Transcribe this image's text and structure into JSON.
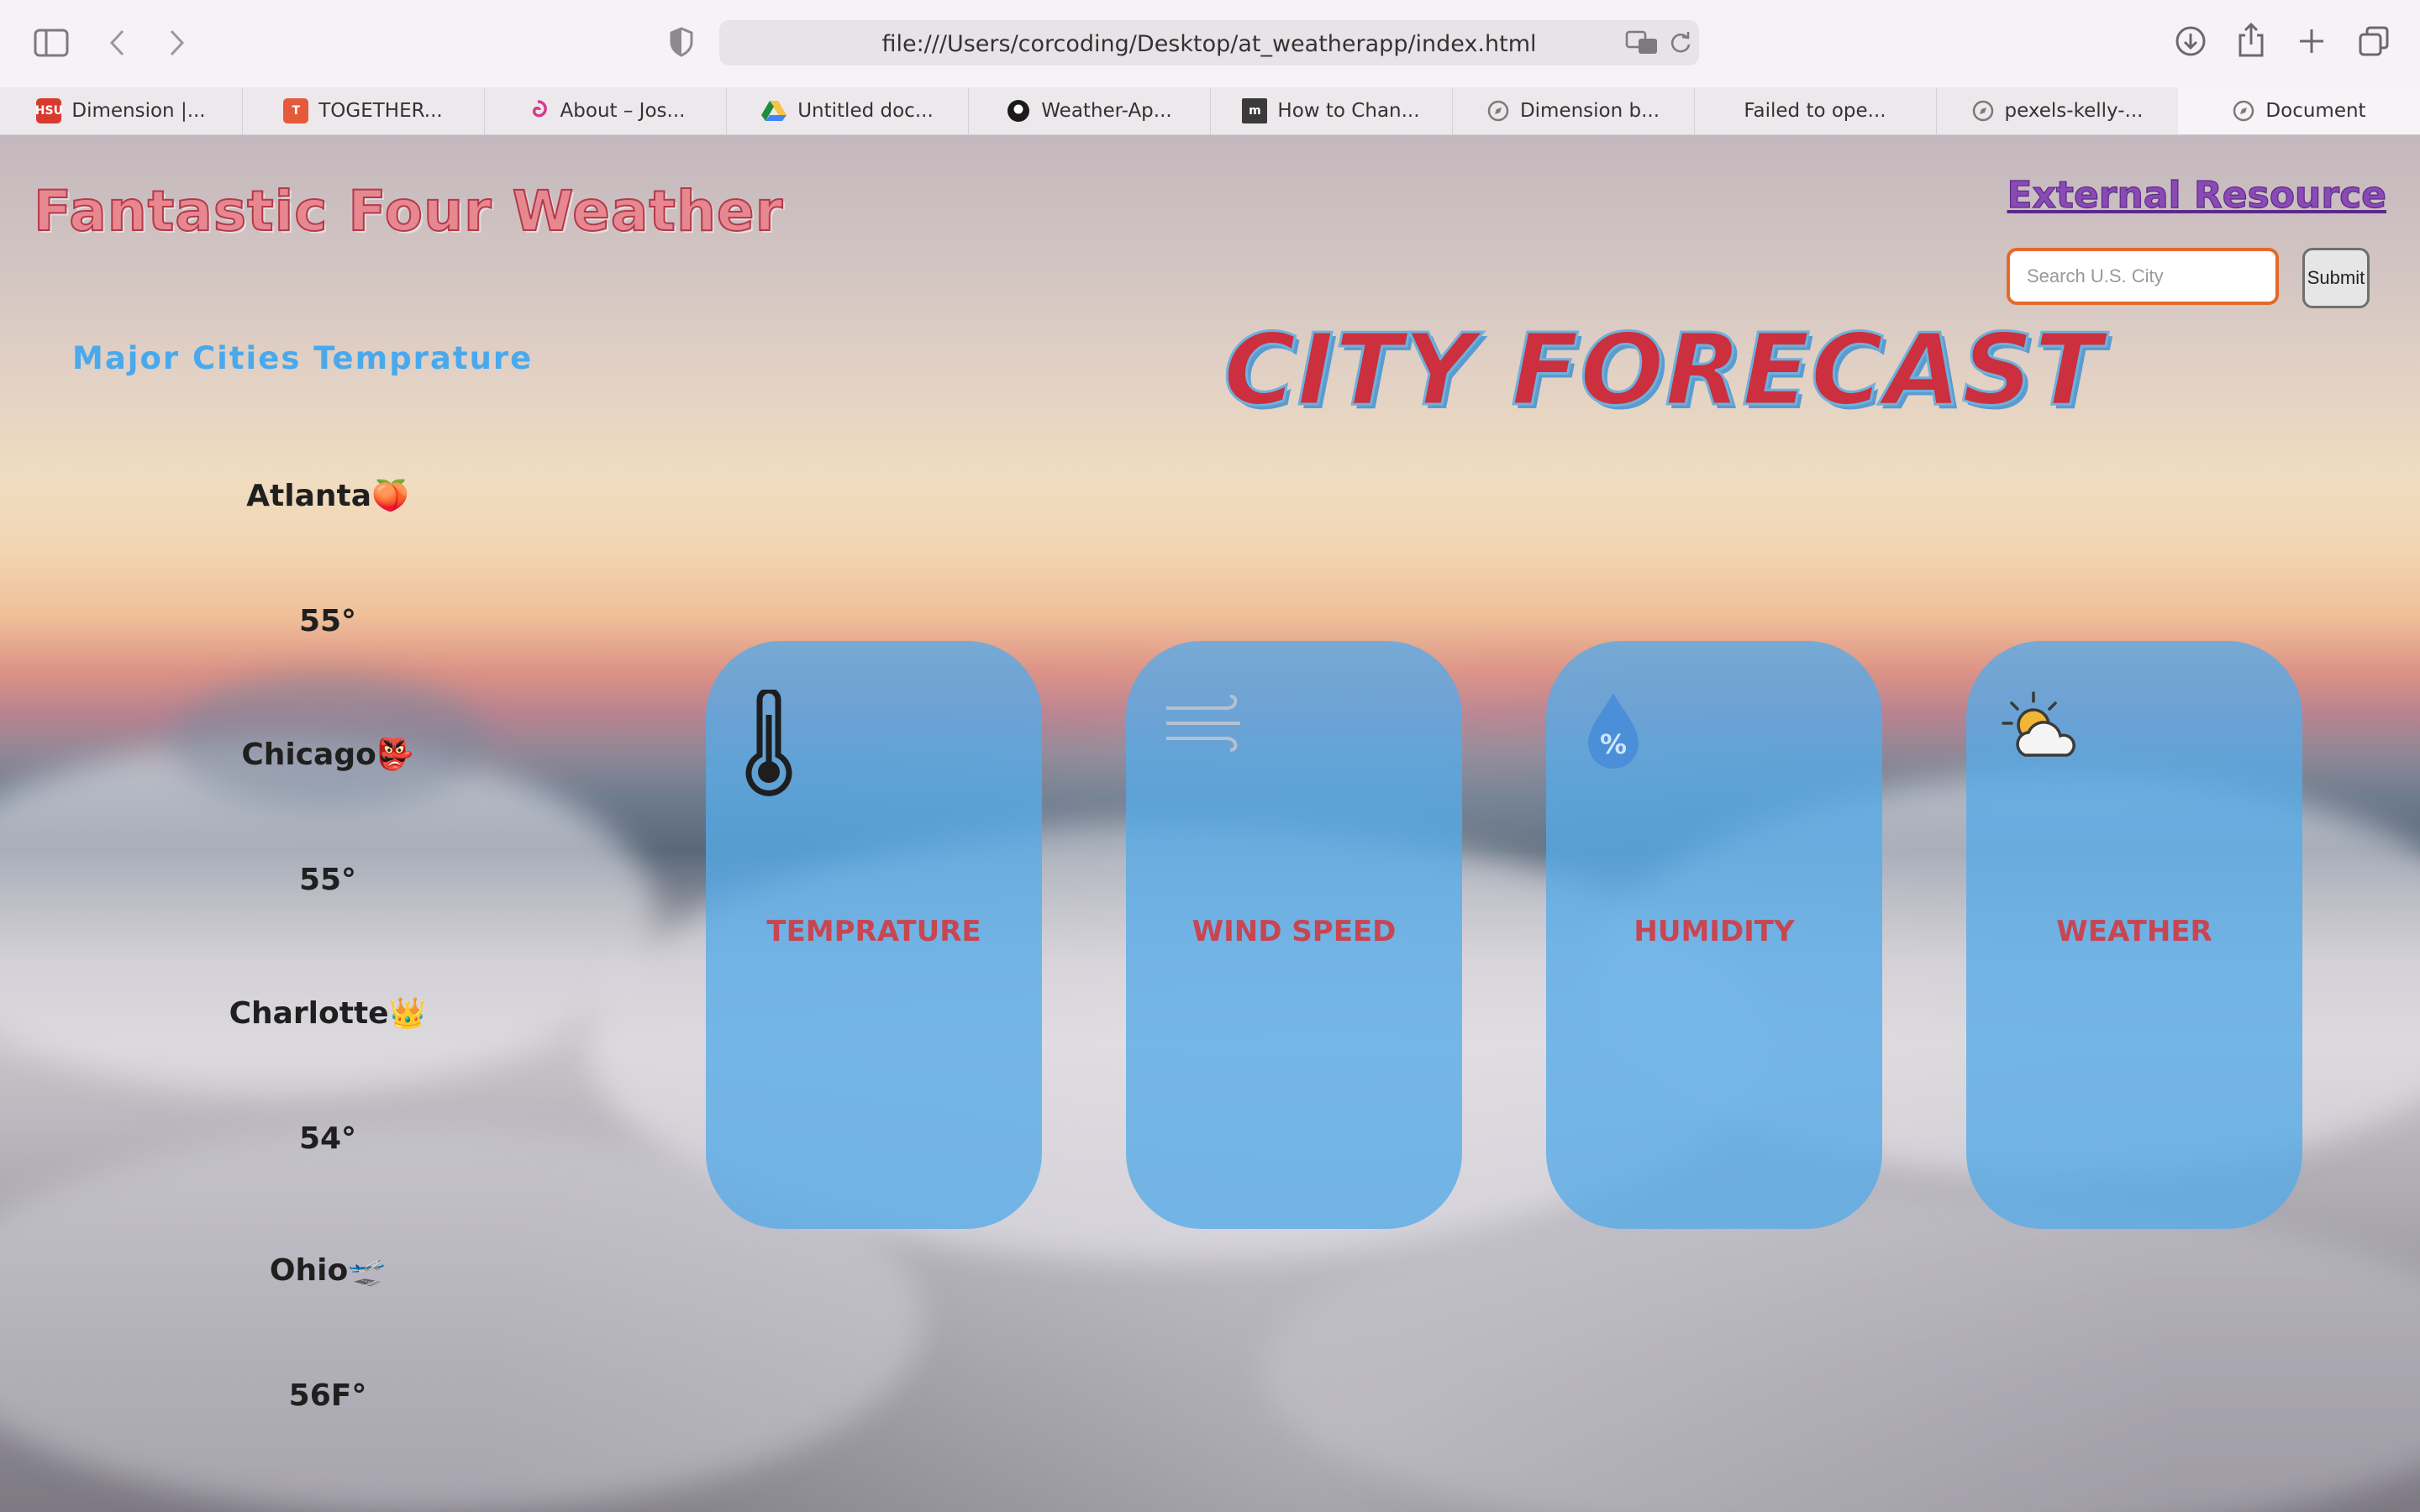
{
  "browser": {
    "url": "file:///Users/corcoding/Desktop/at_weatherapp/index.html",
    "tabs": [
      {
        "label": "Dimension |...",
        "icon": "hsu-favicon",
        "icon_text": "HSU",
        "color": "#d83a2e"
      },
      {
        "label": "TOGETHER...",
        "icon": "t-favicon",
        "icon_text": "T",
        "color": "#e55a3a"
      },
      {
        "label": "About – Jos...",
        "icon": "spiral-favicon",
        "icon_text": "",
        "color": "#d63a8a"
      },
      {
        "label": "Untitled doc...",
        "icon": "google-drive-favicon",
        "icon_text": "",
        "color": "#2a9d4a"
      },
      {
        "label": "Weather-Ap...",
        "icon": "github-favicon",
        "icon_text": "",
        "color": "#1b1b1b"
      },
      {
        "label": "How to Chan...",
        "icon": "m-favicon",
        "icon_text": "m",
        "color": "#3a3a3a"
      },
      {
        "label": "Dimension b...",
        "icon": "compass-favicon",
        "icon_text": "",
        "color": "#7a7a7a"
      },
      {
        "label": "Failed to ope...",
        "icon": "none",
        "icon_text": "",
        "color": ""
      },
      {
        "label": "pexels-kelly-...",
        "icon": "compass-favicon",
        "icon_text": "",
        "color": "#7a7a7a"
      },
      {
        "label": "Document",
        "icon": "compass-favicon",
        "icon_text": "",
        "color": "#7a7a7a"
      }
    ]
  },
  "header": {
    "title": "Fantastic Four Weather",
    "external_link": "External Resource"
  },
  "search": {
    "placeholder": "Search U.S. City",
    "value": "",
    "submit_label": "Submit"
  },
  "sidebar": {
    "title": "Major Cities Temprature",
    "cities": [
      {
        "name": "Atlanta",
        "emoji": "🍑",
        "temp": "55°"
      },
      {
        "name": "Chicago",
        "emoji": "👺",
        "temp": "55°"
      },
      {
        "name": "Charlotte",
        "emoji": "👑",
        "temp": "54°"
      },
      {
        "name": "Ohio",
        "emoji": "🛫",
        "temp": "56F°"
      }
    ]
  },
  "forecast": {
    "title": "CITY FORECAST",
    "cards": [
      {
        "label": "TEMPRATURE",
        "icon": "thermometer-icon"
      },
      {
        "label": "WIND SPEED",
        "icon": "wind-icon"
      },
      {
        "label": "HUMIDITY",
        "icon": "humidity-drop-icon"
      },
      {
        "label": "WEATHER",
        "icon": "partly-cloudy-icon"
      }
    ]
  },
  "colors": {
    "title": "#e7878f",
    "link": "#8a4ab6",
    "sidebar_title": "#49a9ec",
    "forecast_title": "#cc2f3d",
    "card_bg": "#56abe8",
    "card_label": "#c84552",
    "search_border": "#e46a2c"
  }
}
